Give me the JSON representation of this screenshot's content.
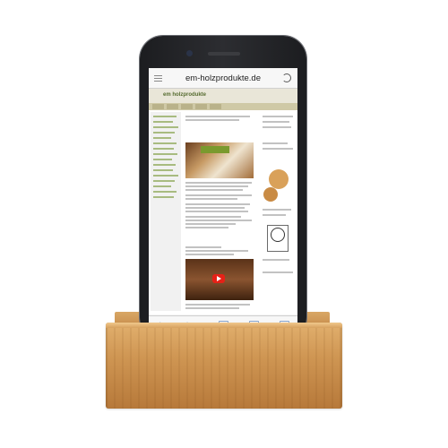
{
  "colors": {
    "wood": "#cf9653",
    "phone_body": "#2c2d31",
    "accent_green": "#7a9a2e",
    "video_play": "#e62117"
  },
  "browser": {
    "url": "em-holzprodukte.de",
    "menu_icon": "hamburger-icon",
    "reload_icon": "reload-icon"
  },
  "page": {
    "logo": "em holzprodukte"
  }
}
